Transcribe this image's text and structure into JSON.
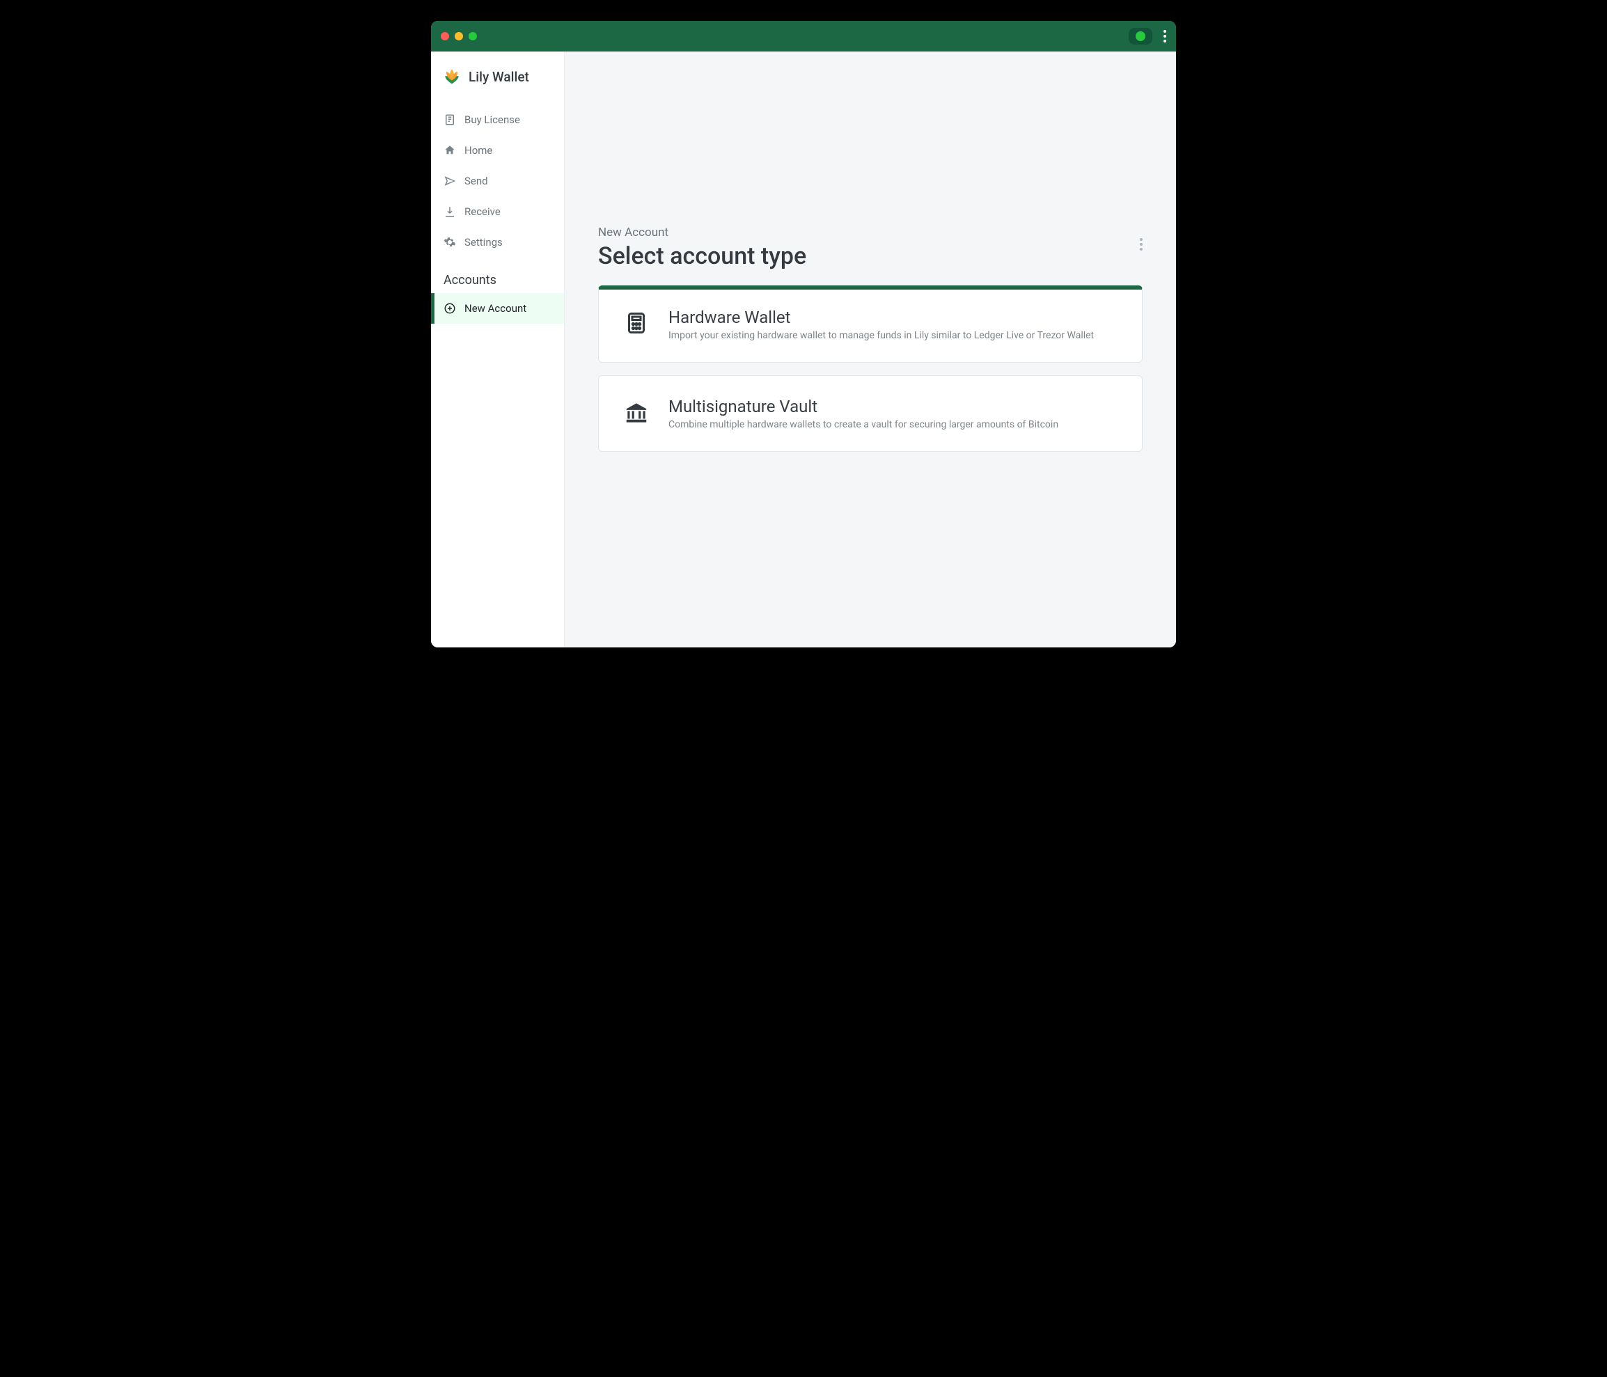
{
  "brand": {
    "name": "Lily Wallet"
  },
  "sidebar": {
    "items": [
      {
        "label": "Buy License"
      },
      {
        "label": "Home"
      },
      {
        "label": "Send"
      },
      {
        "label": "Receive"
      },
      {
        "label": "Settings"
      }
    ],
    "section_label": "Accounts",
    "new_account_label": "New Account"
  },
  "page": {
    "eyebrow": "New Account",
    "title": "Select account type"
  },
  "options": [
    {
      "title": "Hardware Wallet",
      "desc": "Import your existing hardware wallet to manage funds in Lily similar to Ledger Live or Trezor Wallet",
      "selected": true
    },
    {
      "title": "Multisignature Vault",
      "desc": "Combine multiple hardware wallets to create a vault for securing larger amounts of Bitcoin",
      "selected": false
    }
  ]
}
